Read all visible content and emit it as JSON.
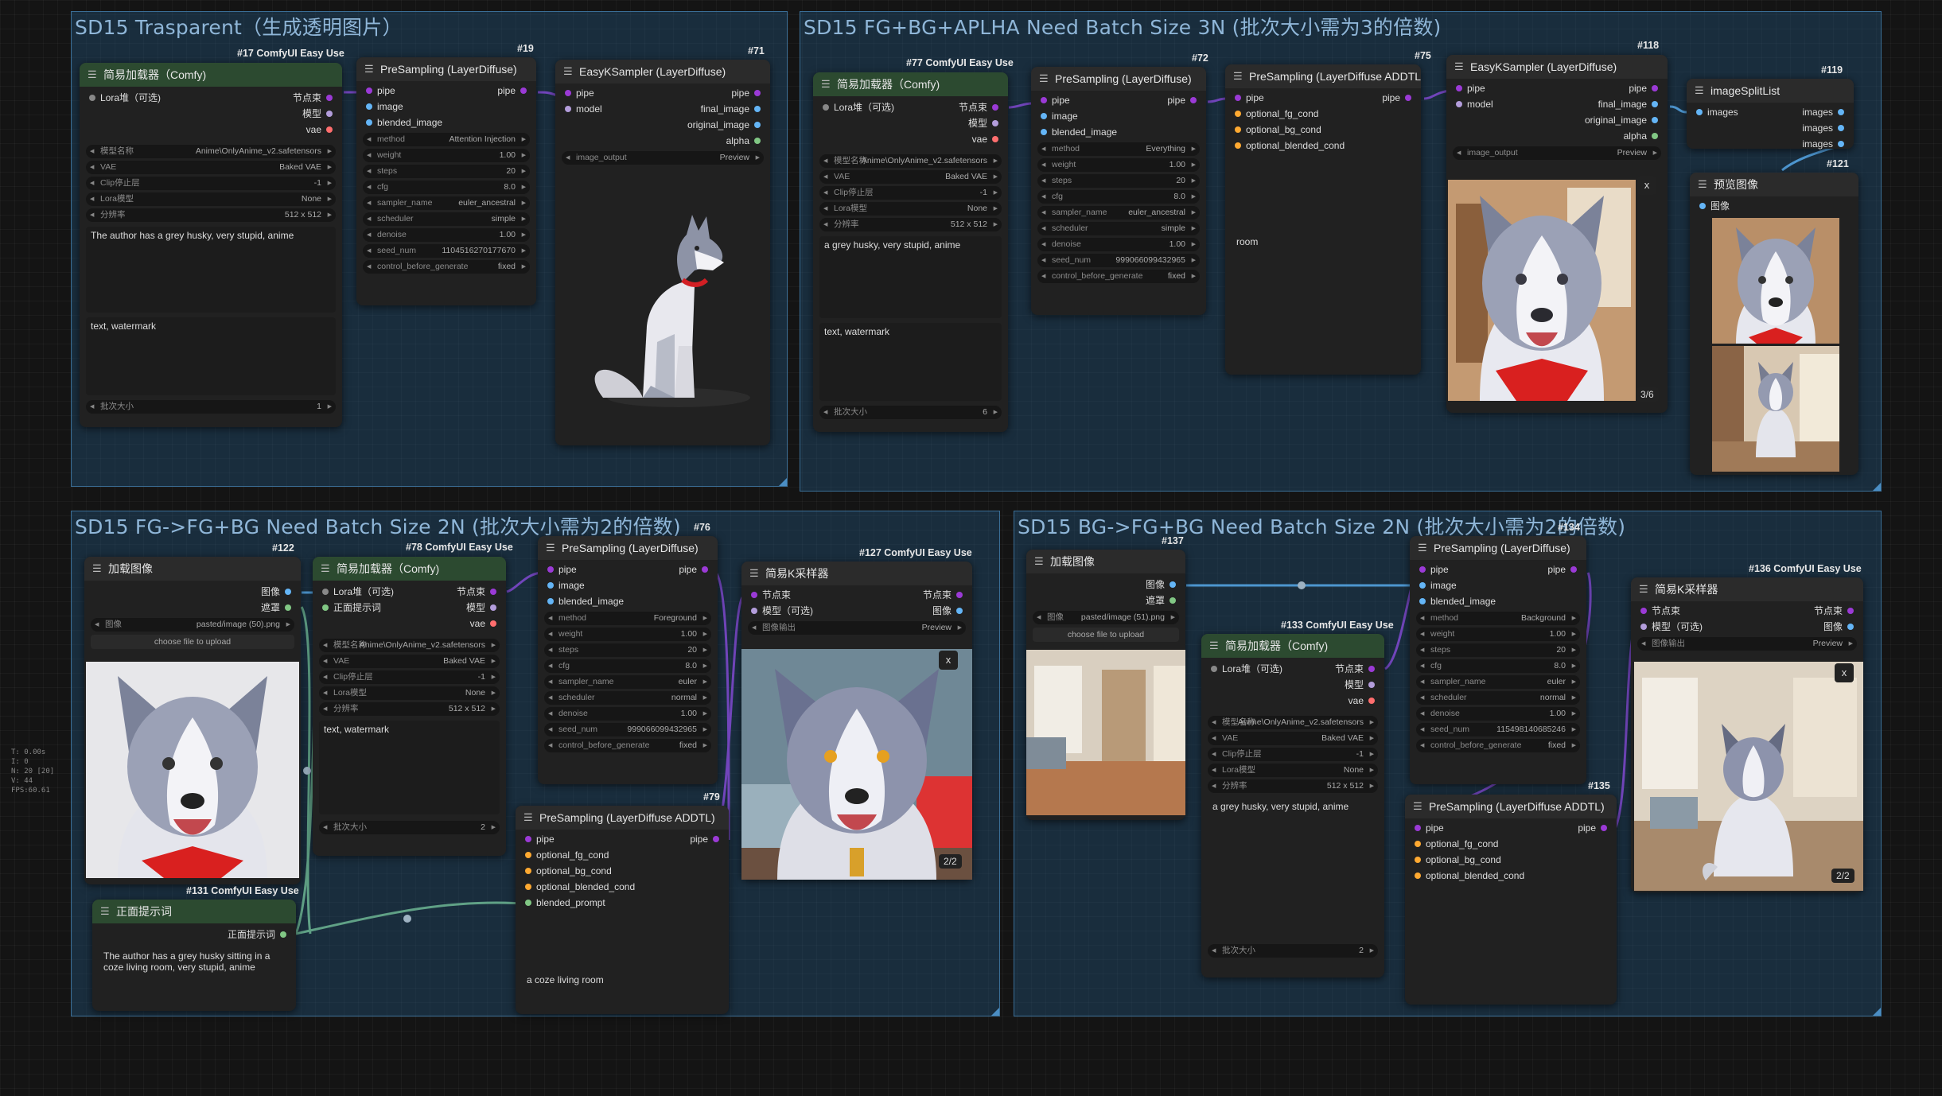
{
  "colors": {
    "group_fill": "#225c8a",
    "group_border": "#3a6e96",
    "pipe": "#9b3ad6",
    "image": "#64b5f6",
    "vae": "#ff6e6e",
    "mask": "#81c784",
    "cond": "#ffa931",
    "model": "#b39ddb",
    "lora": "#888888"
  },
  "groups": {
    "g1": "SD15 Trasparent（生成透明图片）",
    "g2": "SD15 FG+BG+APLHA Need Batch Size 3N (批次大小需为3的倍数)",
    "g3": "SD15 FG->FG+BG Need Batch Size 2N (批次大小需为2的倍数)",
    "g4": "SD15 BG->FG+BG Need Batch Size 2N (批次大小需为2的倍数)"
  },
  "n17": {
    "id": "#17 ComfyUI Easy Use",
    "title": "简易加载器（Comfy)",
    "in_lora": "Lora堆（可选)",
    "out_pipe": "节点束",
    "out_model": "模型",
    "out_vae": "vae",
    "w": [
      [
        "模型名称",
        "Anime\\OnlyAnime_v2.safetensors"
      ],
      [
        "VAE",
        "Baked VAE"
      ],
      [
        "Clip停止层",
        "-1"
      ],
      [
        "Lora模型",
        "None"
      ],
      [
        "分辨率",
        "512 x 512"
      ]
    ],
    "pos": "The author has a grey husky, very stupid, anime",
    "neg": "text, watermark",
    "batch_k": "批次大小",
    "batch_v": "1"
  },
  "n19": {
    "id": "#19",
    "title": "PreSampling (LayerDiffuse)",
    "in": [
      "pipe",
      "image",
      "blended_image"
    ],
    "out": "pipe",
    "w": [
      [
        "method",
        "Attention Injection"
      ],
      [
        "weight",
        "1.00"
      ],
      [
        "steps",
        "20"
      ],
      [
        "cfg",
        "8.0"
      ],
      [
        "sampler_name",
        "euler_ancestral"
      ],
      [
        "scheduler",
        "simple"
      ],
      [
        "denoise",
        "1.00"
      ],
      [
        "seed_num",
        "1104516270177670"
      ],
      [
        "control_before_generate",
        "fixed"
      ]
    ]
  },
  "n71": {
    "id": "#71",
    "title": "EasyKSampler (LayerDiffuse)",
    "in": [
      "pipe",
      "model"
    ],
    "out": [
      "pipe",
      "final_image",
      "original_image",
      "alpha"
    ],
    "w": [
      "image_output",
      "Preview"
    ]
  },
  "n77": {
    "id": "#77 ComfyUI Easy Use",
    "title": "简易加载器（Comfy)",
    "in_lora": "Lora堆（可选)",
    "out_pipe": "节点束",
    "out_model": "模型",
    "out_vae": "vae",
    "w": [
      [
        "模型名称",
        "Anime\\OnlyAnime_v2.safetensors"
      ],
      [
        "VAE",
        "Baked VAE"
      ],
      [
        "Clip停止层",
        "-1"
      ],
      [
        "Lora模型",
        "None"
      ],
      [
        "分辨率",
        "512 x 512"
      ]
    ],
    "pos": "a grey husky, very stupid, anime",
    "neg": "text, watermark",
    "batch_k": "批次大小",
    "batch_v": "6"
  },
  "n72": {
    "id": "#72",
    "title": "PreSampling (LayerDiffuse)",
    "in": [
      "pipe",
      "image",
      "blended_image"
    ],
    "out": "pipe",
    "w": [
      [
        "method",
        "Everything"
      ],
      [
        "weight",
        "1.00"
      ],
      [
        "steps",
        "20"
      ],
      [
        "cfg",
        "8.0"
      ],
      [
        "sampler_name",
        "euler_ancestral"
      ],
      [
        "scheduler",
        "simple"
      ],
      [
        "denoise",
        "1.00"
      ],
      [
        "seed_num",
        "999066099432965"
      ],
      [
        "control_before_generate",
        "fixed"
      ]
    ]
  },
  "n75": {
    "id": "#75",
    "title": "PreSampling (LayerDiffuse ADDTL)",
    "in": [
      "pipe",
      "optional_fg_cond",
      "optional_bg_cond",
      "optional_blended_cond"
    ],
    "out": "pipe",
    "prompt": "room"
  },
  "n118": {
    "id": "#118",
    "title": "EasyKSampler (LayerDiffuse)",
    "in": [
      "pipe",
      "model"
    ],
    "out": [
      "pipe",
      "final_image",
      "original_image",
      "alpha"
    ],
    "w": [
      "image_output",
      "Preview"
    ],
    "badge": "3/6",
    "x": "x"
  },
  "n119": {
    "id": "#119",
    "title": "imageSplitList",
    "in": "images",
    "out": [
      "images",
      "images",
      "images"
    ]
  },
  "n121": {
    "id": "#121",
    "title": "预览图像",
    "in": "图像"
  },
  "n122": {
    "id": "#122",
    "title": "加载图像",
    "out": [
      "图像",
      "遮罩"
    ],
    "w": [
      "图像",
      "pasted/image (50).png"
    ],
    "btn": "choose file to upload"
  },
  "n78": {
    "id": "#78 ComfyUI Easy Use",
    "title": "简易加载器（Comfy)",
    "in_lora": "Lora堆（可选)",
    "in_pos": "正面提示词",
    "out_pipe": "节点束",
    "out_model": "模型",
    "out_vae": "vae",
    "w": [
      [
        "模型名称",
        "Anime\\OnlyAnime_v2.safetensors"
      ],
      [
        "VAE",
        "Baked VAE"
      ],
      [
        "Clip停止层",
        "-1"
      ],
      [
        "Lora模型",
        "None"
      ],
      [
        "分辨率",
        "512 x 512"
      ]
    ],
    "neg": "text, watermark",
    "batch_k": "批次大小",
    "batch_v": "2"
  },
  "n76": {
    "id": "#76",
    "title": "PreSampling (LayerDiffuse)",
    "in": [
      "pipe",
      "image",
      "blended_image"
    ],
    "out": "pipe",
    "w": [
      [
        "method",
        "Foreground"
      ],
      [
        "weight",
        "1.00"
      ],
      [
        "steps",
        "20"
      ],
      [
        "cfg",
        "8.0"
      ],
      [
        "sampler_name",
        "euler"
      ],
      [
        "scheduler",
        "normal"
      ],
      [
        "denoise",
        "1.00"
      ],
      [
        "seed_num",
        "999066099432965"
      ],
      [
        "control_before_generate",
        "fixed"
      ]
    ]
  },
  "n79": {
    "id": "#79",
    "title": "PreSampling (LayerDiffuse ADDTL)",
    "in": [
      "pipe",
      "optional_fg_cond",
      "optional_bg_cond",
      "optional_blended_cond",
      "blended_prompt"
    ],
    "out": "pipe",
    "prompt": "a coze living room"
  },
  "n127": {
    "id": "#127 ComfyUI Easy Use",
    "title": "简易K采样器",
    "in": [
      "节点束",
      "模型（可选)"
    ],
    "out": [
      "节点束",
      "图像"
    ],
    "w": [
      "图像输出",
      "Preview"
    ],
    "badge": "2/2",
    "x": "x"
  },
  "n131": {
    "id": "#131 ComfyUI Easy Use",
    "title": "正面提示词",
    "out": "正面提示词",
    "text": "The author has a grey husky sitting in a coze living room, very stupid, anime"
  },
  "n137": {
    "id": "#137",
    "title": "加载图像",
    "out": [
      "图像",
      "遮罩"
    ],
    "w": [
      "图像",
      "pasted/image (51).png"
    ],
    "btn": "choose file to upload"
  },
  "n133": {
    "id": "#133 ComfyUI Easy Use",
    "title": "简易加载器（Comfy)",
    "in_lora": "Lora堆（可选)",
    "out_pipe": "节点束",
    "out_model": "模型",
    "out_vae": "vae",
    "w": [
      [
        "模型名称",
        "Anime\\OnlyAnime_v2.safetensors"
      ],
      [
        "VAE",
        "Baked VAE"
      ],
      [
        "Clip停止层",
        "-1"
      ],
      [
        "Lora模型",
        "None"
      ],
      [
        "分辨率",
        "512 x 512"
      ]
    ],
    "pos": "a grey husky, very stupid, anime",
    "batch_k": "批次大小",
    "batch_v": "2"
  },
  "n134": {
    "id": "#134",
    "title": "PreSampling (LayerDiffuse)",
    "in": [
      "pipe",
      "image",
      "blended_image"
    ],
    "out": "pipe",
    "w": [
      [
        "method",
        "Background"
      ],
      [
        "weight",
        "1.00"
      ],
      [
        "steps",
        "20"
      ],
      [
        "cfg",
        "8.0"
      ],
      [
        "sampler_name",
        "euler"
      ],
      [
        "scheduler",
        "normal"
      ],
      [
        "denoise",
        "1.00"
      ],
      [
        "seed_num",
        "115498140685246"
      ],
      [
        "control_before_generate",
        "fixed"
      ]
    ]
  },
  "n135": {
    "id": "#135",
    "title": "PreSampling (LayerDiffuse ADDTL)",
    "in": [
      "pipe",
      "optional_fg_cond",
      "optional_bg_cond",
      "optional_blended_cond"
    ],
    "out": "pipe"
  },
  "n136": {
    "id": "#136 ComfyUI Easy Use",
    "title": "简易K采样器",
    "in": [
      "节点束",
      "模型（可选)"
    ],
    "out": [
      "节点束",
      "图像"
    ],
    "w": [
      "图像输出",
      "Preview"
    ],
    "badge": "2/2",
    "x": "x"
  },
  "stats": [
    "T: 0.00s",
    "I: 0",
    "N: 20 [20]",
    "V: 44",
    "FPS:60.61"
  ]
}
